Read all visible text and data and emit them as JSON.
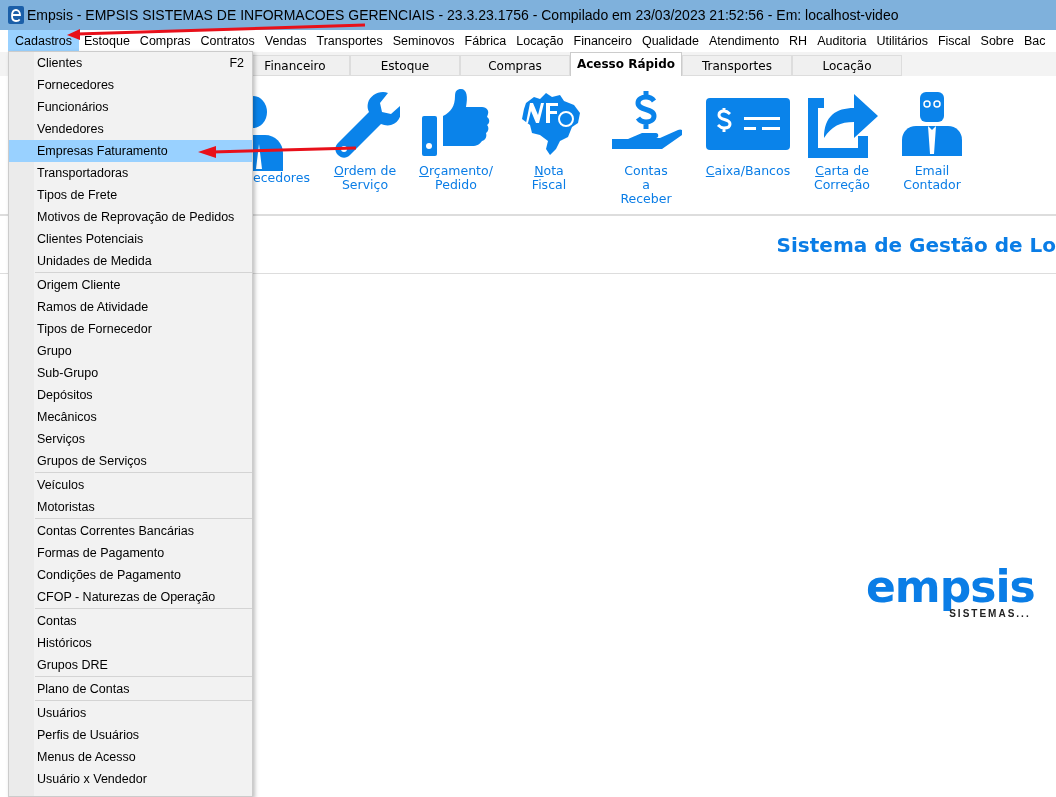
{
  "window": {
    "title": "Empsis - EMPSIS SISTEMAS DE INFORMACOES GERENCIAIS - 23.3.23.1756 - Compilado em 23/03/2023 21:52:56 - Em: localhost-video"
  },
  "menu_bar": [
    {
      "label": "Cadastros",
      "selected": true
    },
    {
      "label": "Estoque",
      "selected": false
    },
    {
      "label": "Compras",
      "selected": false
    },
    {
      "label": "Contratos",
      "selected": false
    },
    {
      "label": "Vendas",
      "selected": false
    },
    {
      "label": "Transportes",
      "selected": false
    },
    {
      "label": "Seminovos",
      "selected": false
    },
    {
      "label": "Fábrica",
      "selected": false
    },
    {
      "label": "Locação",
      "selected": false
    },
    {
      "label": "Financeiro",
      "selected": false
    },
    {
      "label": "Qualidade",
      "selected": false
    },
    {
      "label": "Atendimento",
      "selected": false
    },
    {
      "label": "RH",
      "selected": false
    },
    {
      "label": "Auditoria",
      "selected": false
    },
    {
      "label": "Utilitários",
      "selected": false
    },
    {
      "label": "Fiscal",
      "selected": false
    },
    {
      "label": "Sobre",
      "selected": false
    },
    {
      "label": "Bac",
      "selected": false
    }
  ],
  "tabs": [
    {
      "label": "Financeiro",
      "selected": false
    },
    {
      "label": "Estoque",
      "selected": false
    },
    {
      "label": "Compras",
      "selected": false
    },
    {
      "label": "Acesso Rápido",
      "selected": true
    },
    {
      "label": "Transportes",
      "selected": false
    },
    {
      "label": "Locação",
      "selected": false
    }
  ],
  "shortcuts": [
    {
      "kind": "person",
      "label": "ecedores",
      "mnemonic": false
    },
    {
      "kind": "wrench",
      "label": "Ordem de\nServiço",
      "mnemonic": true
    },
    {
      "kind": "thumb",
      "label": "Orçamento/\nPedido",
      "mnemonic": true
    },
    {
      "kind": "nfe",
      "label": "Nota\nFiscal",
      "mnemonic": true
    },
    {
      "kind": "hand",
      "label": "Contas\na\nReceber",
      "mnemonic": false
    },
    {
      "kind": "cash",
      "label": "Caixa/Bancos",
      "mnemonic": true
    },
    {
      "kind": "share",
      "label": "Carta de\nCorreção",
      "mnemonic": true
    },
    {
      "kind": "accountant",
      "label": "Email\nContador",
      "mnemonic": false
    }
  ],
  "heading": "Sistema de Gestão de Lo",
  "logo": {
    "name": "empsis",
    "tagline": "SISTEMAS..."
  },
  "dropdown": {
    "groups": [
      [
        {
          "label": "Clientes",
          "shortcut": "F2",
          "selected": false
        },
        {
          "label": "Fornecedores",
          "selected": false
        },
        {
          "label": "Funcionários",
          "selected": false
        },
        {
          "label": "Vendedores",
          "selected": false
        },
        {
          "label": "Empresas Faturamento",
          "selected": true
        },
        {
          "label": "Transportadoras",
          "selected": false
        },
        {
          "label": "Tipos de Frete",
          "selected": false
        },
        {
          "label": "Motivos de Reprovação de Pedidos",
          "selected": false
        },
        {
          "label": "Clientes Potenciais",
          "selected": false
        },
        {
          "label": "Unidades de Medida",
          "selected": false
        }
      ],
      [
        {
          "label": "Origem Cliente",
          "selected": false
        },
        {
          "label": "Ramos de Atividade",
          "selected": false
        },
        {
          "label": "Tipos de Fornecedor",
          "selected": false
        },
        {
          "label": "Grupo",
          "selected": false
        },
        {
          "label": "Sub-Grupo",
          "selected": false
        },
        {
          "label": "Depósitos",
          "selected": false
        },
        {
          "label": "Mecânicos",
          "selected": false
        },
        {
          "label": "Serviços",
          "selected": false
        },
        {
          "label": "Grupos de Serviços",
          "selected": false
        }
      ],
      [
        {
          "label": "Veículos",
          "selected": false
        },
        {
          "label": "Motoristas",
          "selected": false
        }
      ],
      [
        {
          "label": "Contas Correntes Bancárias",
          "selected": false
        },
        {
          "label": "Formas de Pagamento",
          "selected": false
        },
        {
          "label": "Condições de Pagamento",
          "selected": false
        },
        {
          "label": "CFOP - Naturezas de Operação",
          "selected": false
        }
      ],
      [
        {
          "label": "Contas",
          "selected": false
        },
        {
          "label": "Históricos",
          "selected": false
        },
        {
          "label": "Grupos DRE",
          "selected": false
        }
      ],
      [
        {
          "label": "Plano de Contas",
          "selected": false
        }
      ],
      [
        {
          "label": "Usuários",
          "selected": false
        },
        {
          "label": "Perfis de Usuários",
          "selected": false
        },
        {
          "label": "Menus de Acesso",
          "selected": false
        },
        {
          "label": "Usuário x Vendedor",
          "selected": false
        }
      ]
    ]
  }
}
